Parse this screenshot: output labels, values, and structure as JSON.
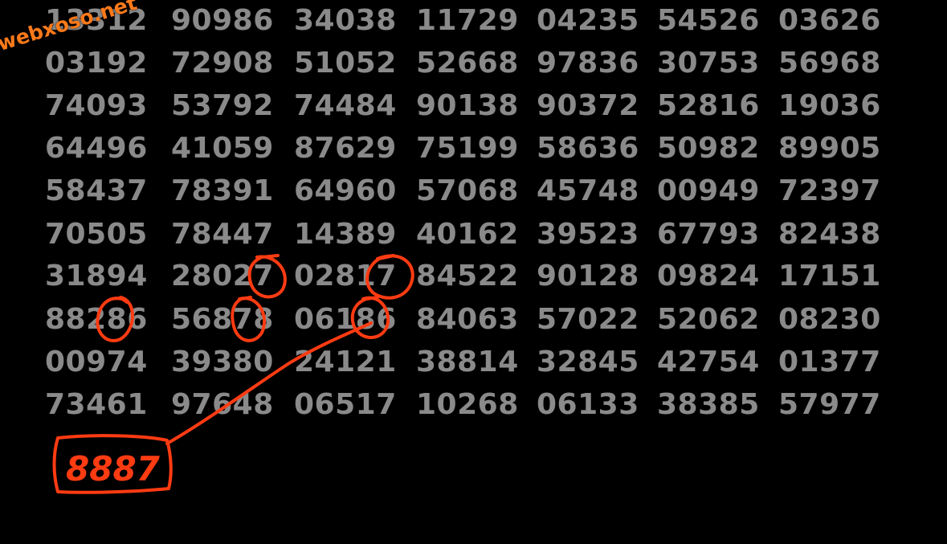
{
  "watermark": "webxoso.net",
  "grid": {
    "rows": [
      [
        "13312",
        "90986",
        "34038",
        "11729",
        "04235",
        "54526",
        "03626"
      ],
      [
        "03192",
        "72908",
        "51052",
        "52668",
        "97836",
        "30753",
        "56968"
      ],
      [
        "74093",
        "53792",
        "74484",
        "90138",
        "90372",
        "52816",
        "19036"
      ],
      [
        "64496",
        "41059",
        "87629",
        "75199",
        "58636",
        "50982",
        "89905"
      ],
      [
        "58437",
        "78391",
        "64960",
        "57068",
        "45748",
        "00949",
        "72397"
      ],
      [
        "70505",
        "78447",
        "14389",
        "40162",
        "39523",
        "67793",
        "82438"
      ],
      [
        "31894",
        "28027",
        "02817",
        "84522",
        "90128",
        "09824",
        "17151"
      ],
      [
        "88286",
        "56878",
        "06186",
        "84063",
        "57022",
        "52062",
        "08230"
      ],
      [
        "00974",
        "39380",
        "24121",
        "38814",
        "32845",
        "42754",
        "01377"
      ],
      [
        "73461",
        "97648",
        "06517",
        "10268",
        "06133",
        "38385",
        "57977"
      ]
    ]
  },
  "annotation": {
    "result": "8887",
    "stroke_color": "#ff3b12"
  }
}
